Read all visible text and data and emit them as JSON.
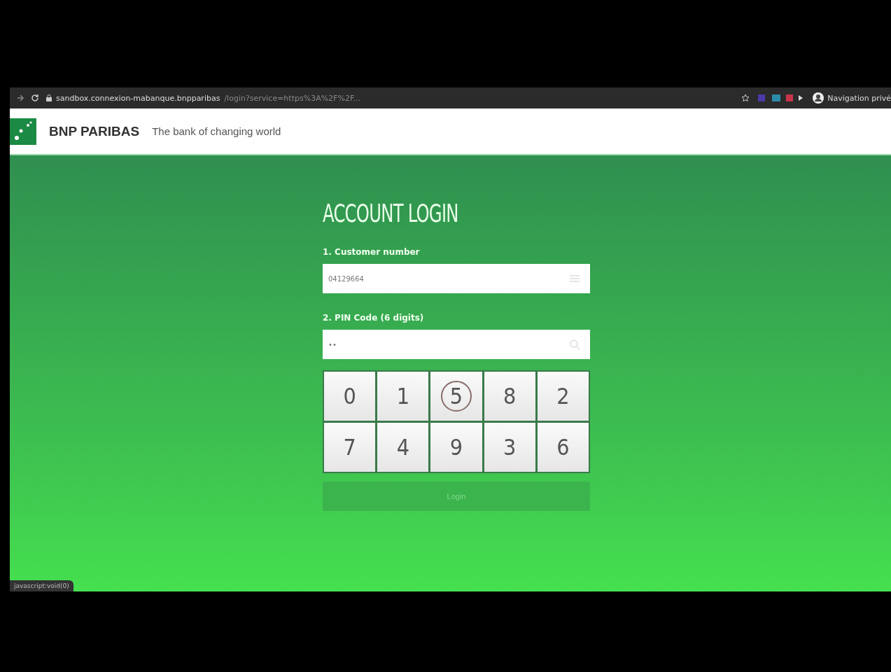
{
  "browser": {
    "url_host": "sandbox.connexion-mabanque.bnpparibas",
    "url_path": "/login?service=https%3A%2F%2F...",
    "profile_label": "Navigation privé"
  },
  "header": {
    "brand": "BNP PARIBAS",
    "tagline": "The bank of changing world"
  },
  "form": {
    "title": "ACCOUNT LOGIN",
    "customer": {
      "label": "1. Customer number",
      "value": "04129664"
    },
    "pin": {
      "label": "2. PIN Code (6 digits)",
      "value": "••"
    },
    "keypad": [
      {
        "digit": "0",
        "hovered": false
      },
      {
        "digit": "1",
        "hovered": false
      },
      {
        "digit": "5",
        "hovered": true
      },
      {
        "digit": "8",
        "hovered": false
      },
      {
        "digit": "2",
        "hovered": false
      },
      {
        "digit": "7",
        "hovered": false
      },
      {
        "digit": "4",
        "hovered": false
      },
      {
        "digit": "9",
        "hovered": false
      },
      {
        "digit": "3",
        "hovered": false
      },
      {
        "digit": "6",
        "hovered": false
      }
    ],
    "login_button": {
      "label": "Login",
      "disabled": true
    }
  },
  "status_bar": {
    "text": "javascript:void(0)"
  }
}
